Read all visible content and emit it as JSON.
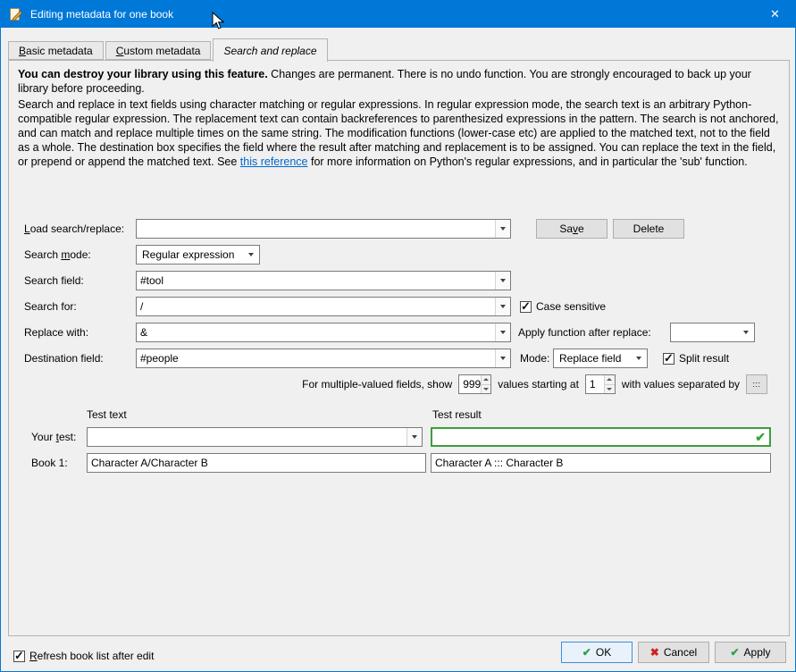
{
  "window": {
    "title": "Editing metadata for one book",
    "close_icon": "✕"
  },
  "tabs": [
    {
      "label": "&Basic metadata"
    },
    {
      "label": "&Custom metadata"
    },
    {
      "label": "Search and replace"
    }
  ],
  "warning_bold": "You can destroy your library using this feature.",
  "warning_rest": " Changes are permanent. There is no undo function. You are strongly encouraged to back up your library before proceeding.",
  "description_before_link": "Search and replace in text fields using character matching or regular expressions. In regular expression mode, the search text is an arbitrary Python-compatible regular expression. The replacement text can contain backreferences to parenthesized expressions in the pattern. The search is not anchored, and can match and replace multiple times on the same string. The modification functions (lower-case etc) are applied to the matched text, not to the field as a whole. The destination box specifies the field where the result after matching and replacement is to be assigned. You can replace the text in the field, or prepend or append the matched text. See ",
  "description_link": "this reference",
  "description_after_link": " for more information on Python's regular expressions, and in particular the 'sub' function.",
  "form": {
    "load_label": "&Load search/replace:",
    "load_value": "",
    "save_button": "Sa&ve",
    "delete_button": "Delete",
    "search_mode_label": "Search &mode:",
    "search_mode_value": "Regular expression",
    "search_field_label": "Search field:",
    "search_field_value": "#tool",
    "search_for_label": "Search for:",
    "search_for_value": "/",
    "case_sensitive_label": "Case sensitive",
    "case_sensitive_checked": true,
    "replace_with_label": "Replace with:",
    "replace_with_value": "&",
    "apply_function_label": "Apply function after replace:",
    "apply_function_value": "",
    "destination_label": "Destination field:",
    "destination_value": "#people",
    "mode_label": "Mode:",
    "mode_value": "Replace field",
    "split_result_label": "Split result",
    "split_result_checked": true,
    "multi_text_show": "For multiple-valued fields, show",
    "multi_show_value": "999",
    "multi_text_start": "values starting at",
    "multi_start_value": "1",
    "multi_text_sep": "with values separated by",
    "separator_button": ":::"
  },
  "test": {
    "text_header": "Test text",
    "result_header": "Test result",
    "your_test_label": "Your &test:",
    "your_test_value": "",
    "your_test_result": "",
    "result_ok_icon": "✔",
    "book1_label": "Book 1:",
    "book1_value": "Character A/Character B",
    "book1_result": "Character A ::: Character B"
  },
  "footer": {
    "refresh_label": "&Refresh book list after edit",
    "refresh_checked": true,
    "ok_icon": "✔",
    "ok_label": "OK",
    "cancel_icon": "✖",
    "cancel_label": "Cancel",
    "apply_icon": "✔",
    "apply_label": "Apply"
  },
  "colors": {
    "titlebar": "#0078d7",
    "link": "#0066cc",
    "success_green": "#3ba13b",
    "cancel_red": "#d22020"
  }
}
